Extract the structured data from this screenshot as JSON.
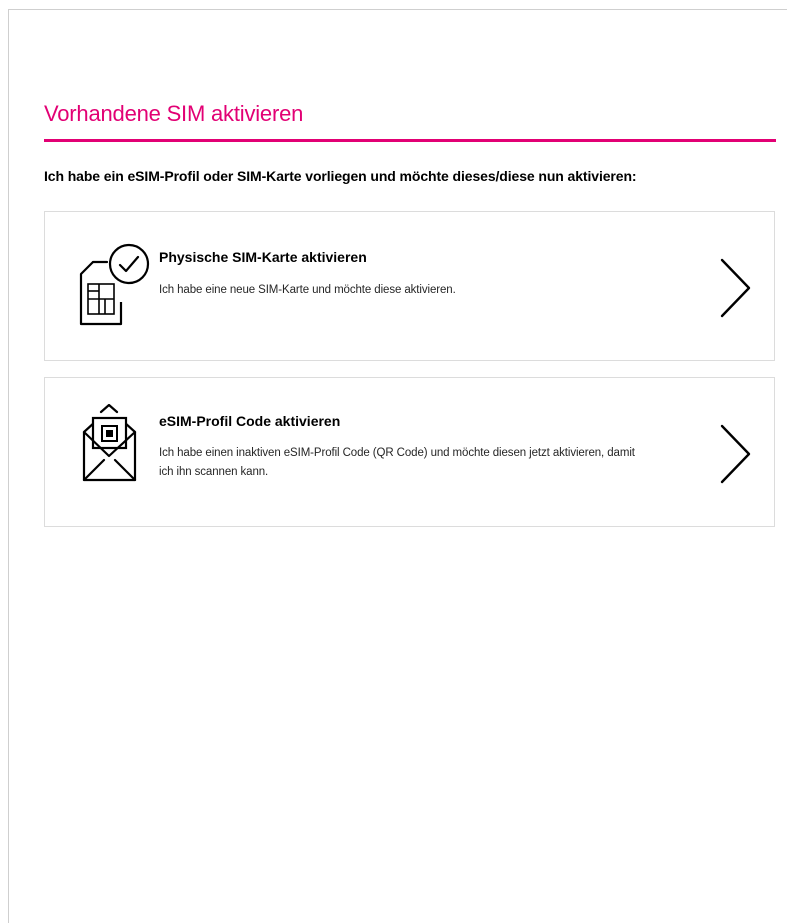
{
  "page": {
    "title": "Vorhandene SIM aktivieren",
    "intro": "Ich habe ein eSIM-Profil oder SIM-Karte vorliegen und möchte dieses/diese nun aktivieren:",
    "accent_color": "#e20074"
  },
  "options": [
    {
      "heading": "Physische SIM-Karte aktivieren",
      "description": "Ich habe eine neue SIM-Karte und möchte diese aktivieren.",
      "icon": "sim-card-check-icon",
      "arrow_icon": "chevron-right-icon"
    },
    {
      "heading": "eSIM-Profil Code aktivieren",
      "description": "Ich habe einen inaktiven eSIM-Profil Code (QR Code) und möchte diesen jetzt aktivieren, damit ich ihn scannen kann.",
      "icon": "envelope-qr-code-icon",
      "arrow_icon": "chevron-right-icon"
    }
  ]
}
